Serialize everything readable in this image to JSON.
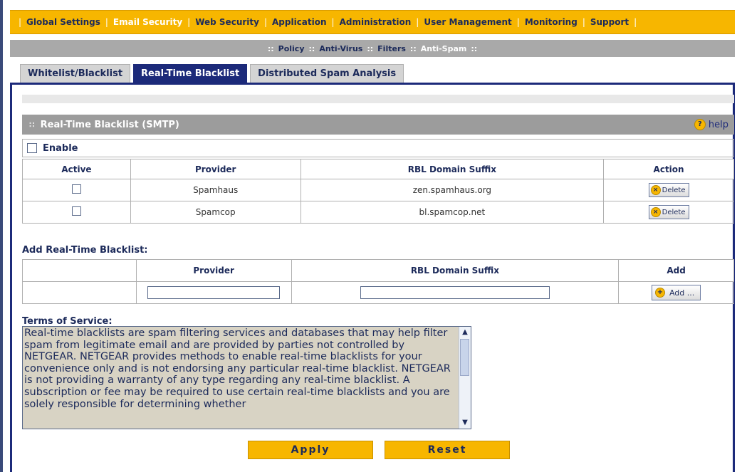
{
  "topnav": {
    "items": [
      "Global Settings",
      "Email Security",
      "Web Security",
      "Application",
      "Administration",
      "User Management",
      "Monitoring",
      "Support"
    ]
  },
  "subnav": {
    "items": [
      "Policy",
      "Anti-Virus",
      "Filters",
      "Anti-Spam"
    ]
  },
  "tabs": [
    "Whitelist/Blacklist",
    "Real-Time Blacklist",
    "Distributed Spam Analysis"
  ],
  "section": {
    "title": "Real-Time Blacklist (SMTP)",
    "help": "help"
  },
  "enable_label": "Enable",
  "list": {
    "headers": [
      "Active",
      "Provider",
      "RBL Domain Suffix",
      "Action"
    ],
    "rows": [
      {
        "provider": "Spamhaus",
        "suffix": "zen.spamhaus.org",
        "action": "Delete"
      },
      {
        "provider": "Spamcop",
        "suffix": "bl.spamcop.net",
        "action": "Delete"
      }
    ]
  },
  "add": {
    "title": "Add Real-Time Blacklist:",
    "headers": [
      "",
      "Provider",
      "RBL Domain Suffix",
      "Add"
    ],
    "button": "Add ..."
  },
  "tos": {
    "title": "Terms of Service:",
    "text": "Real-time blacklists are spam filtering services and databases that may help filter spam from legitimate email and are provided by parties not controlled by NETGEAR. NETGEAR provides methods to enable real-time blacklists for your convenience only and is not endorsing any particular real-time blacklist. NETGEAR is not providing a warranty of any type regarding any real-time blacklist. A subscription or fee may be required to use certain real-time blacklists and you are solely responsible for determining whether"
  },
  "buttons": {
    "apply": "Apply",
    "reset": "Reset"
  },
  "colors": {
    "accent": "#f7b600",
    "navy": "#1c2a7a",
    "header_grey": "#9c9c9c"
  }
}
